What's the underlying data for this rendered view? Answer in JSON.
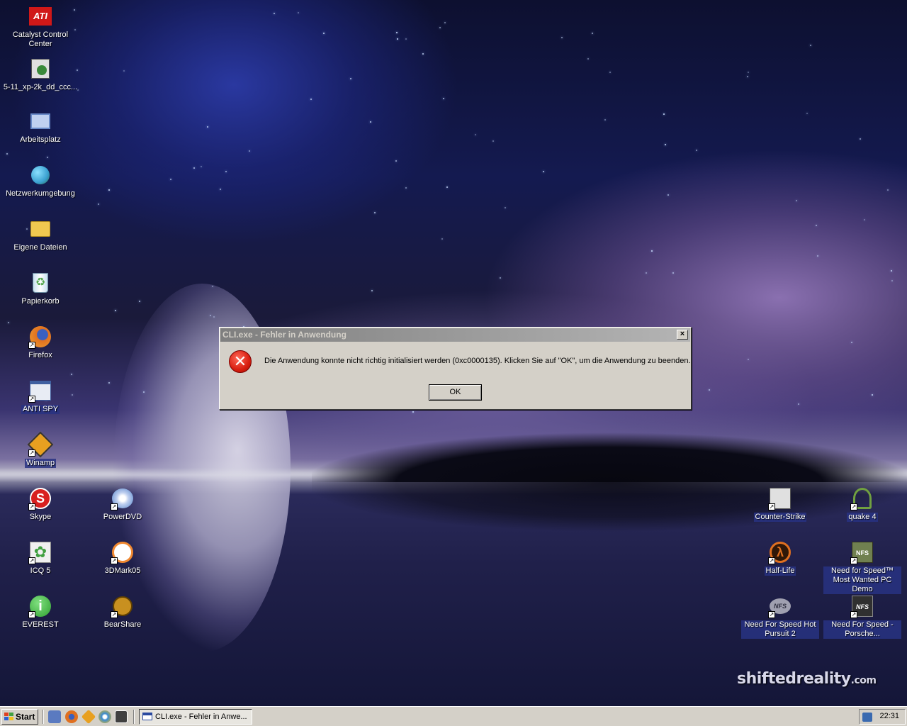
{
  "desktop": {
    "brand": {
      "main": "shiftedreality",
      "suffix": ".com"
    },
    "icons": [
      {
        "label": "Catalyst Control Center",
        "icon": "ati-icon",
        "color": "#d01818"
      },
      {
        "label": "5-11_xp-2k_dd_ccc...",
        "icon": "installer-icon",
        "color": "#3a8a3a"
      },
      {
        "label": "Arbeitsplatz",
        "icon": "computer-icon",
        "color": "#6a8ac8"
      },
      {
        "label": "Netzwerkumgebung",
        "icon": "network-icon",
        "color": "#3aa0d0"
      },
      {
        "label": "Eigene Dateien",
        "icon": "folder-icon",
        "color": "#f0c850"
      },
      {
        "label": "Papierkorb",
        "icon": "recycle-bin-icon",
        "color": "#58a850"
      },
      {
        "label": "Firefox",
        "icon": "firefox-icon",
        "color": "#e07020"
      },
      {
        "label": "ANTI SPY",
        "icon": "antispy-icon",
        "color": "#4060a0"
      },
      {
        "label": "Winamp",
        "icon": "winamp-icon",
        "color": "#e8a020"
      },
      {
        "label": "Skype",
        "icon": "skype-icon",
        "color": "#d82020"
      },
      {
        "label": "PowerDVD",
        "icon": "powerdvd-icon",
        "color": "#5080c8"
      },
      {
        "label": "ICQ 5",
        "icon": "icq-icon",
        "color": "#40a040"
      },
      {
        "label": "3DMark05",
        "icon": "3dmark-icon",
        "color": "#f08830"
      },
      {
        "label": "EVEREST",
        "icon": "everest-icon",
        "color": "#30a030"
      },
      {
        "label": "BearShare",
        "icon": "bearshare-icon",
        "color": "#c89020"
      },
      {
        "label": "Counter-Strike",
        "icon": "counter-strike-icon",
        "color": "#c0c0c0"
      },
      {
        "label": "quake 4",
        "icon": "quake-icon",
        "color": "#70a040"
      },
      {
        "label": "Half-Life",
        "icon": "half-life-icon",
        "color": "#e07020"
      },
      {
        "label": "Need for Speed™ Most Wanted PC Demo",
        "icon": "nfs-mw-icon",
        "color": "#708050"
      },
      {
        "label": "Need For Speed Hot Pursuit 2",
        "icon": "nfs-hp2-icon",
        "color": "#a0a0b0"
      },
      {
        "label": "Need For Speed - Porsche...",
        "icon": "nfs-porsche-icon",
        "color": "#303030"
      }
    ]
  },
  "dialog": {
    "title": "CLI.exe - Fehler in Anwendung",
    "close_label": "×",
    "icon": "error-icon",
    "icon_glyph": "✕",
    "message": "Die Anwendung konnte nicht richtig initialisiert werden (0xc0000135). Klicken Sie auf \"OK\", um die Anwendung zu beenden.",
    "ok_label": "OK"
  },
  "taskbar": {
    "start_label": "Start",
    "quick_launch": [
      {
        "icon": "show-desktop-icon",
        "color": "#5a7ac0"
      },
      {
        "icon": "firefox-icon",
        "color": "#e07020"
      },
      {
        "icon": "winamp-icon",
        "color": "#e8a020"
      },
      {
        "icon": "media-player-icon",
        "color": "#3a8ad0"
      },
      {
        "icon": "steam-icon",
        "color": "#404040"
      }
    ],
    "task_label": "CLI.exe - Fehler in Anwe...",
    "clock": "22:31"
  }
}
